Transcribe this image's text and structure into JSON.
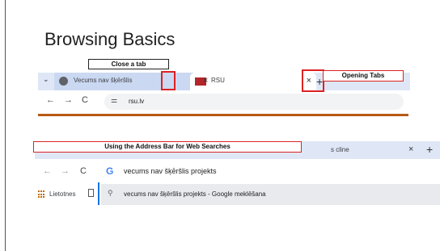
{
  "slide": {
    "title": "Browsing Basics"
  },
  "browser1": {
    "tabs": [
      {
        "title": "Vecums nav šķēršlis",
        "favicon": "globe-icon"
      },
      {
        "title": "RSU",
        "favicon": "rsu-logo-icon"
      }
    ],
    "close_glyph": "×",
    "new_tab_glyph": "+",
    "nav": {
      "back": "←",
      "forward": "→",
      "reload": "C"
    },
    "site_info_glyph": "⚌",
    "url": "rsu.lv"
  },
  "browser2": {
    "tab_tail_text": "s cline",
    "close_glyph": "×",
    "new_tab_glyph": "+",
    "nav": {
      "back": "←",
      "forward": "→",
      "reload": "C"
    },
    "google_glyph": "G",
    "query": "vecums nav šķēršlis projekts",
    "bookmarks_label": "Lietotnes",
    "suggestion": "vecums nav šķēršlis projekts - Google meklēšana",
    "search_glyph": "🔍"
  },
  "callouts": {
    "close_tab": "Close a tab",
    "opening_tabs": "Opening Tabs",
    "address_bar": "Using the Address Bar for Web Searches"
  },
  "colors": {
    "highlight": "#dd2222",
    "accent_rule": "#b85a14",
    "tabstrip": "#dfe7f6"
  }
}
